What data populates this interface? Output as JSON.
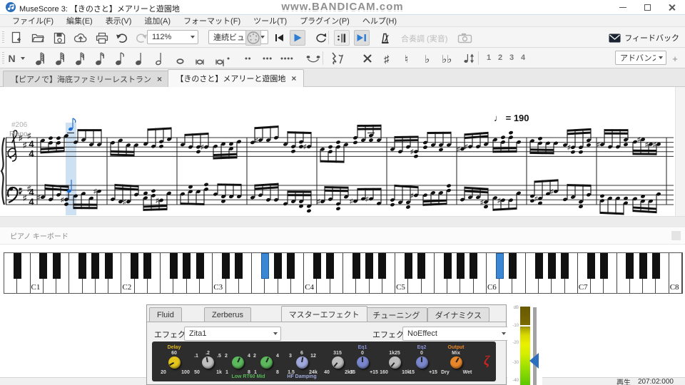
{
  "window": {
    "title": "MuseScore 3: 【きのさと】メアリーと遊園地",
    "watermark": "www.BANDICAM.com"
  },
  "menu_bar": {
    "items": [
      "ファイル(F)",
      "編集(E)",
      "表示(V)",
      "追加(A)",
      "フォーマット(F)",
      "ツール(T)",
      "プラグイン(P)",
      "ヘルプ(H)"
    ]
  },
  "toolbar_main": {
    "file_icons": [
      "new-score",
      "open",
      "save",
      "upload-cloud",
      "print",
      "undo",
      "redo"
    ],
    "zoom_value": "112%",
    "view_mode": "連続ビュー",
    "playback_icons": [
      "midi-input",
      "rewind",
      "play",
      "loop",
      "play-repeats",
      "pan-score",
      "metronome"
    ],
    "concert_pitch_label": "合奏調 (実音)",
    "capture_icon": "camera",
    "feedback_label": "フィードバック"
  },
  "toolbar_note": {
    "note_input_label": "N",
    "durations": [
      "128th",
      "64th",
      "32nd",
      "16th",
      "eighth",
      "quarter",
      "half",
      "whole",
      "breve",
      "longa"
    ],
    "dots": [
      1,
      2,
      3,
      4
    ],
    "tie_icon": "tie",
    "rest_icon": "rest",
    "accidentals": [
      "double-sharp",
      "sharp",
      "natural",
      "flat",
      "double-flat"
    ],
    "flip_icon": "flip-direction",
    "voices": [
      "1",
      "2",
      "3",
      "4"
    ],
    "workspace_value": "アドバンス",
    "add_workspace_label": "+"
  },
  "tab_bar": {
    "tabs": [
      {
        "label": "【ピアノで】海底ファミリーレストラン",
        "close": "×",
        "active": false
      },
      {
        "label": "【きのさと】メアリーと遊園地",
        "close": "×",
        "active": true
      }
    ]
  },
  "score": {
    "measure_number": "#206",
    "instrument_label": "Piano",
    "tempo_text": "♩ = 190",
    "key_signature_sharps": 3,
    "time_signature_top": "4",
    "time_signature_bottom": "4",
    "cursor_color": "#4a90d2",
    "played_note_color": "#1f6fd0"
  },
  "piano_panel": {
    "title": "ピアノ キーボード",
    "octave_labels": [
      "C1",
      "C2",
      "C3",
      "C4",
      "C5",
      "C6",
      "C7",
      "C8"
    ],
    "highlighted_keys": [
      "F#3",
      "C#6"
    ],
    "highlight_color": "#3b87d4"
  },
  "synth": {
    "tabs": [
      {
        "label": "Fluid",
        "active": false
      },
      {
        "label": "Zerberus",
        "active": false
      },
      {
        "label": "マスターエフェクト",
        "active": true
      },
      {
        "label": "チューニング",
        "active": false
      },
      {
        "label": "ダイナミクス",
        "active": false
      }
    ],
    "effect_a_label": "エフェクトA:",
    "effect_a_value": "Zita1",
    "effect_b_label": "エフェクトB:",
    "effect_b_value": "NoEffect",
    "zita": {
      "knobs": [
        {
          "name": "delay",
          "color": "#e3c51e",
          "header": "Delay",
          "header_color": "#e0b818",
          "top": "60",
          "ll": "20",
          "lr": "100"
        },
        {
          "name": "xover-freq",
          "color": "#c0c0c0",
          "top": ".2",
          "ul": ".1",
          "ur": ".5",
          "ll": "50",
          "lr": "1k"
        },
        {
          "name": "low-rt60",
          "color": "#5cb85c",
          "ul": "2",
          "ur": "4",
          "ll": "1",
          "lr": "8"
        },
        {
          "name": "mid-rt60",
          "color": "#5cb85c",
          "ul": "2",
          "ur": "4",
          "ll": "1",
          "lr": "8"
        },
        {
          "name": "hf-damping",
          "color": "#9fa8da",
          "top": "6",
          "ul": "3",
          "ur": "12",
          "ll": "1.5",
          "lr": "24k"
        },
        {
          "name": "eq1-freq",
          "color": "#bdbdbd",
          "top": "315",
          "ll": "40",
          "lr": "2k5"
        },
        {
          "name": "eq1-gain",
          "color": "#7986cb",
          "header": "Eq1",
          "header_color": "#8890d8",
          "top": "0",
          "ll": "-15",
          "lr": "+15"
        },
        {
          "name": "eq2-freq",
          "color": "#bdbdbd",
          "top": "1k25",
          "ll": "160",
          "lr": "10k"
        },
        {
          "name": "eq2-gain",
          "color": "#7986cb",
          "header": "Eq2",
          "header_color": "#8890d8",
          "top": "0",
          "ll": "-15",
          "lr": "+15"
        },
        {
          "name": "dry-wet-mix",
          "color": "#e8872a",
          "header": "Output",
          "header_color": "#e8872a",
          "top": "Mix",
          "ll": "Dry",
          "lr": "Wet"
        }
      ],
      "group_labels": [
        {
          "text": "Low  RT60  Mid",
          "color": "#55b855"
        },
        {
          "text": "HF Damping",
          "color": "#9fa8da"
        }
      ],
      "logo": "ζ"
    }
  },
  "level_meter": {
    "scale_labels": [
      "dB",
      "-10",
      "-20",
      "-30",
      "-40"
    ]
  },
  "status_bar": {
    "play_label": "再生",
    "time_value": "207:02:000"
  }
}
